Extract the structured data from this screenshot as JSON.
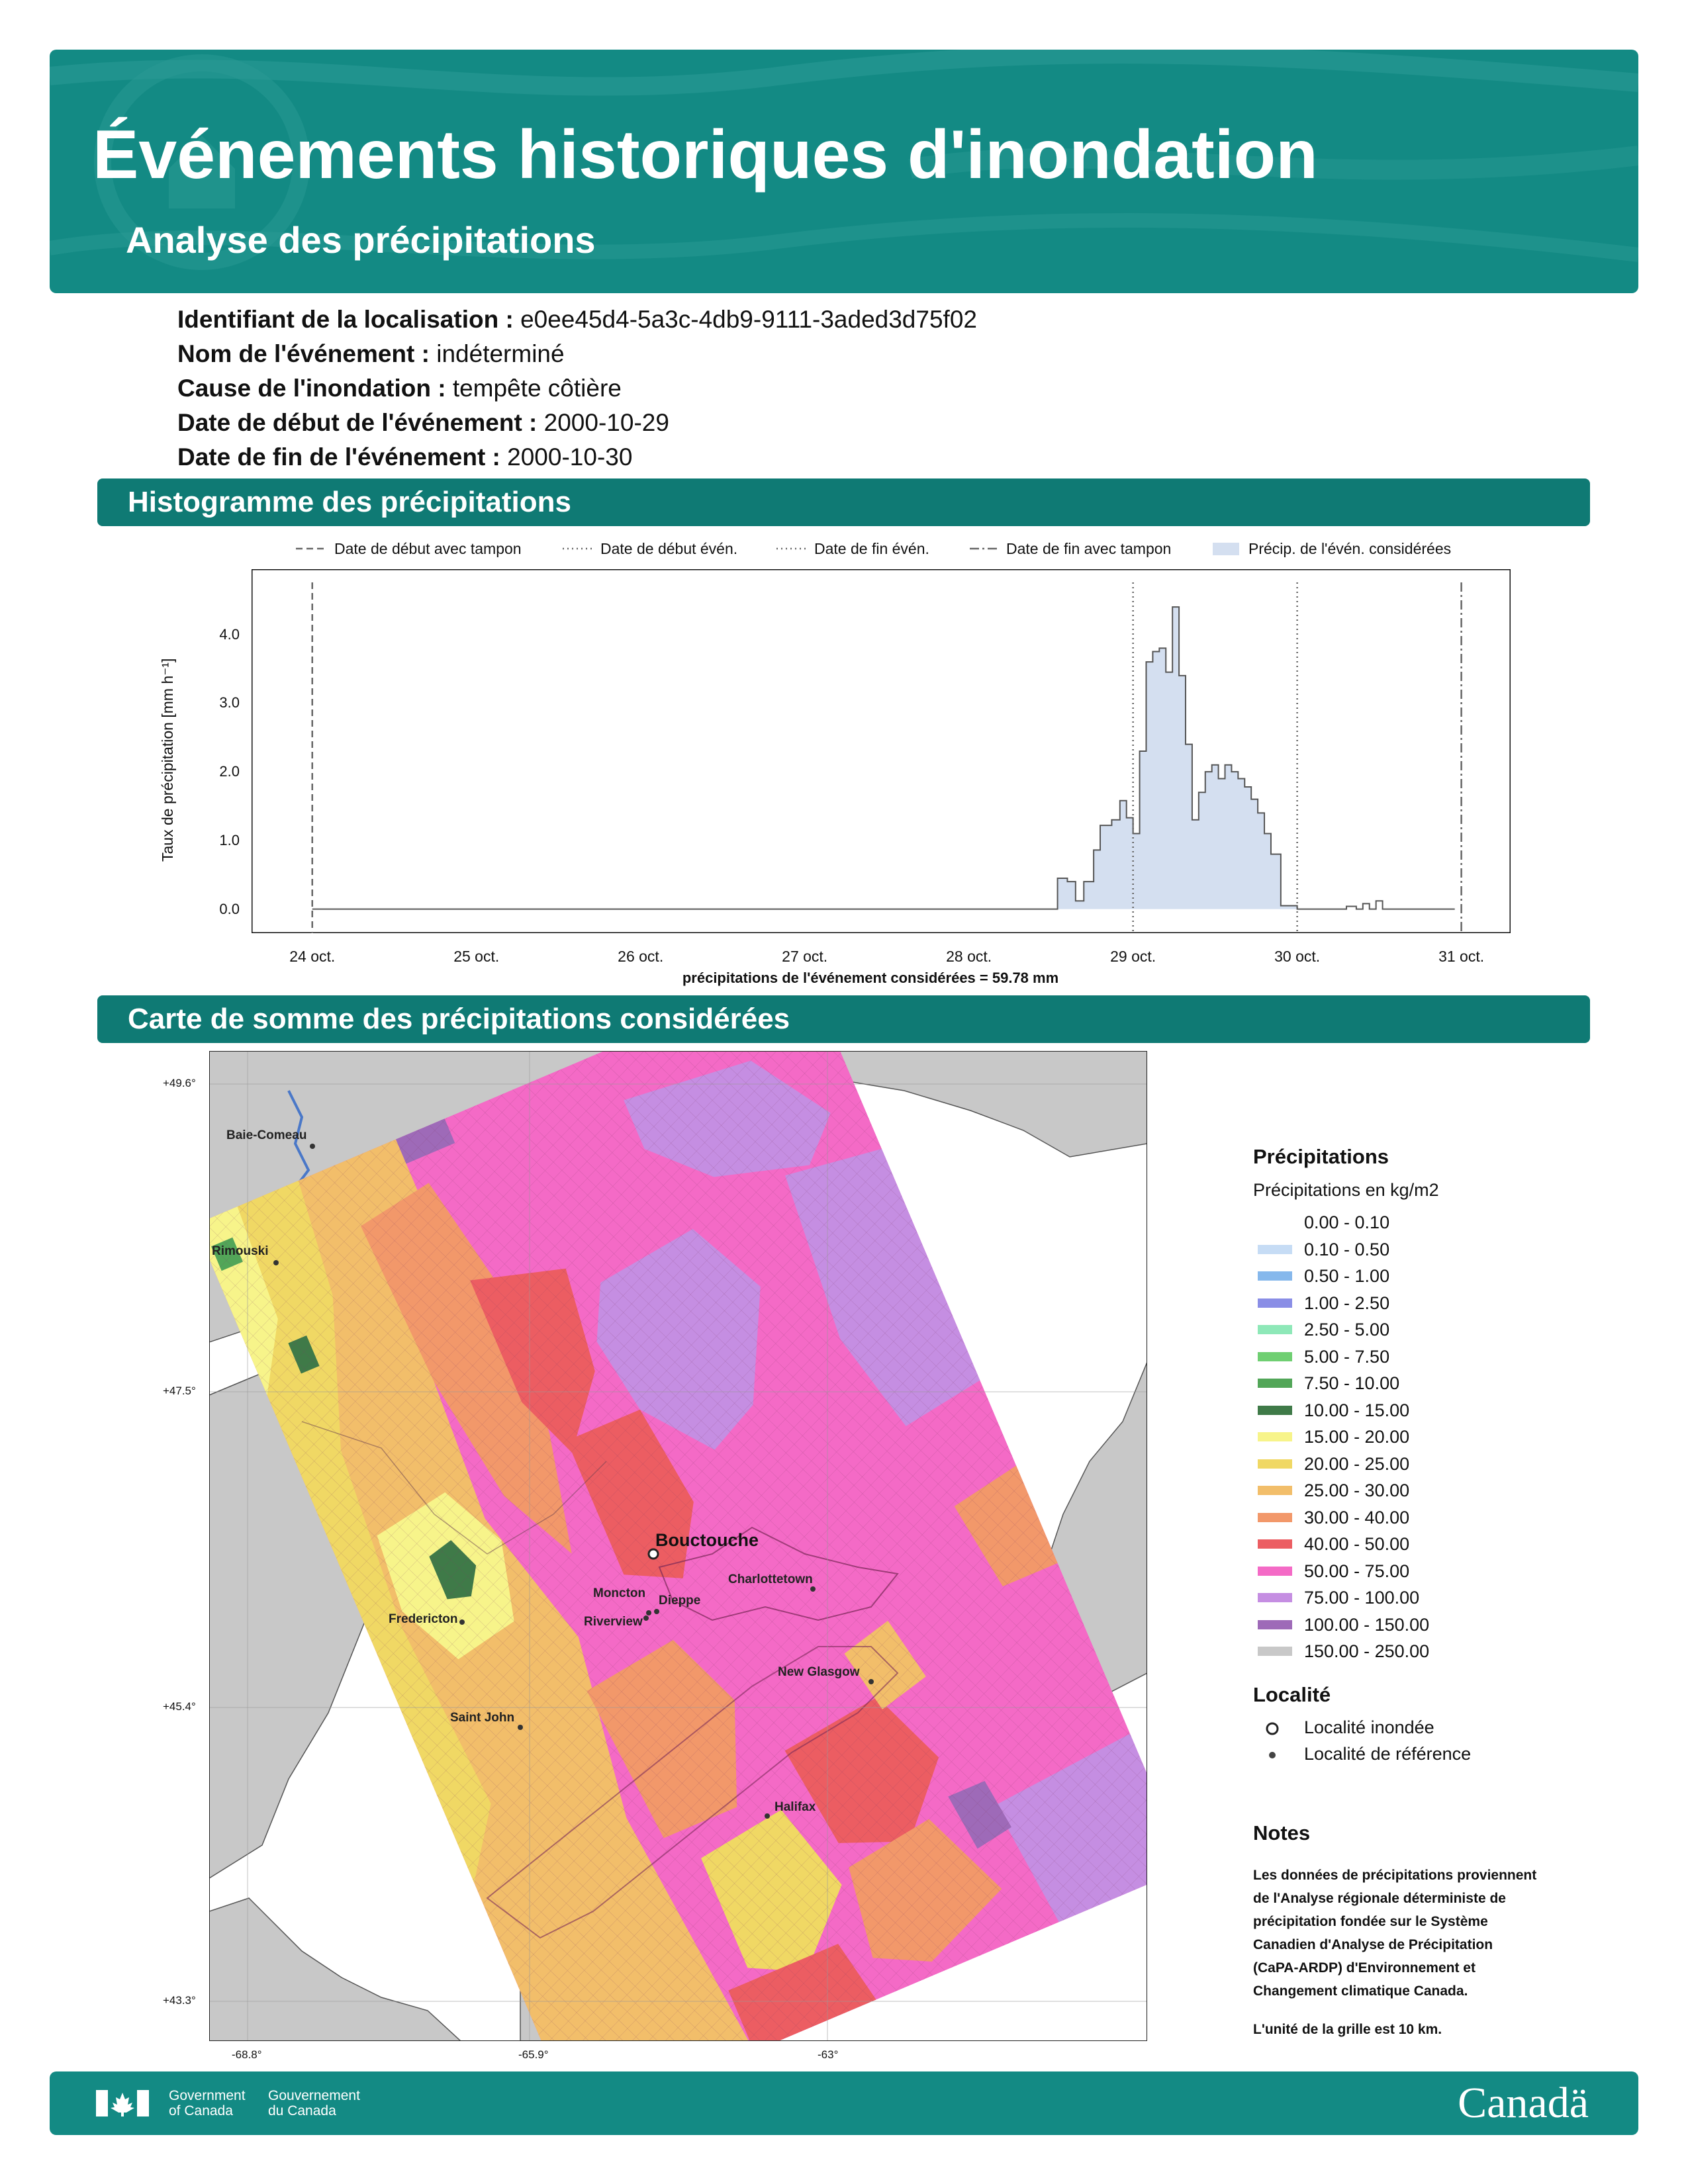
{
  "header": {
    "title": "Événements historiques d'inondation",
    "subtitle": "Analyse des précipitations",
    "background_color": "#138a84"
  },
  "event": [
    {
      "label": "Identifiant de la localisation :",
      "value": "e0ee45d4-5a3c-4db9-9111-3aded3d75f02"
    },
    {
      "label": "Nom de l'événement :",
      "value": "indéterminé"
    },
    {
      "label": "Cause de l'inondation :",
      "value": "tempête côtière"
    },
    {
      "label": "Date de début de l'événement :",
      "value": "2000-10-29"
    },
    {
      "label": "Date de fin de l'événement :",
      "value": "2000-10-30"
    }
  ],
  "sections": {
    "histogram": "Histogramme des précipitations",
    "map": "Carte de somme des précipitations considérées"
  },
  "chart_data": {
    "type": "area",
    "legend": [
      "Date de début avec tampon",
      "Date de début évén.",
      "Date de fin évén.",
      "Date de fin avec tampon",
      "Précip. de l'évén. considérées"
    ],
    "ylabel": "Taux de précipitation [mm h⁻¹]",
    "yticks": [
      "0.0",
      "1.0",
      "2.0",
      "3.0",
      "4.0"
    ],
    "xticks": [
      "24 oct.",
      "25 oct.",
      "26 oct.",
      "27 oct.",
      "28 oct.",
      "29 oct.",
      "30 oct.",
      "31 oct."
    ],
    "xlabel": "précipitations de l'événement considérées = 59.78 mm",
    "ylim": [
      -0.35,
      4.95
    ],
    "xlim_days": [
      23.63,
      31.3
    ],
    "vlines_days": {
      "buffer_start": 24.0,
      "event_start": 29.0,
      "event_end": 30.0,
      "buffer_end": 31.0
    },
    "steps": [
      [
        24.0,
        0.0
      ],
      [
        28.54,
        0.45
      ],
      [
        28.6,
        0.4
      ],
      [
        28.65,
        0.12
      ],
      [
        28.7,
        0.4
      ],
      [
        28.76,
        0.86
      ],
      [
        28.8,
        1.22
      ],
      [
        28.87,
        1.3
      ],
      [
        28.92,
        1.58
      ],
      [
        28.96,
        1.33
      ],
      [
        29.0,
        1.1
      ],
      [
        29.04,
        2.3
      ],
      [
        29.08,
        3.6
      ],
      [
        29.12,
        3.75
      ],
      [
        29.16,
        3.8
      ],
      [
        29.2,
        3.45
      ],
      [
        29.24,
        4.4
      ],
      [
        29.28,
        3.4
      ],
      [
        29.32,
        2.4
      ],
      [
        29.36,
        1.3
      ],
      [
        29.4,
        1.7
      ],
      [
        29.44,
        2.0
      ],
      [
        29.48,
        2.1
      ],
      [
        29.52,
        1.9
      ],
      [
        29.56,
        2.1
      ],
      [
        29.6,
        2.0
      ],
      [
        29.64,
        1.9
      ],
      [
        29.68,
        1.78
      ],
      [
        29.72,
        1.6
      ],
      [
        29.76,
        1.4
      ],
      [
        29.8,
        1.1
      ],
      [
        29.84,
        0.8
      ],
      [
        29.9,
        0.05
      ],
      [
        30.0,
        0.0
      ],
      [
        30.3,
        0.04
      ],
      [
        30.36,
        0.0
      ],
      [
        30.4,
        0.08
      ],
      [
        30.44,
        0.0
      ],
      [
        30.48,
        0.12
      ],
      [
        30.52,
        0.0
      ],
      [
        30.96,
        0.0
      ]
    ],
    "fill_color": "#d4dff0"
  },
  "map": {
    "lat_labels": [
      "+49.6°",
      "+47.5°",
      "+45.4°",
      "+43.3°"
    ],
    "lon_labels": [
      "-68.8°",
      "-65.9°",
      "-63°"
    ],
    "cities": [
      {
        "name": "Baie-Comeau"
      },
      {
        "name": "Rimouski"
      },
      {
        "name": "Bouctouche"
      },
      {
        "name": "Charlottetown"
      },
      {
        "name": "Moncton"
      },
      {
        "name": "Dieppe"
      },
      {
        "name": "Riverview"
      },
      {
        "name": "Fredericton"
      },
      {
        "name": "New Glasgow"
      },
      {
        "name": "Saint John"
      },
      {
        "name": "Halifax"
      }
    ]
  },
  "legend": {
    "title": "Précipitations",
    "subtitle": "Précipitations en kg/m2",
    "classes": [
      {
        "label": "0.00 - 0.10",
        "color": "#ffffff"
      },
      {
        "label": "0.10 - 0.50",
        "color": "#c6dcf5"
      },
      {
        "label": "0.50 - 1.00",
        "color": "#86b8ec"
      },
      {
        "label": "1.00 - 2.50",
        "color": "#8a8ee6"
      },
      {
        "label": "2.50 - 5.00",
        "color": "#8ee8b8"
      },
      {
        "label": "5.00 - 7.50",
        "color": "#6fcf72"
      },
      {
        "label": "7.50 - 10.00",
        "color": "#52a658"
      },
      {
        "label": "10.00 - 15.00",
        "color": "#3f7a48"
      },
      {
        "label": "15.00 - 20.00",
        "color": "#f7f48a"
      },
      {
        "label": "20.00 - 25.00",
        "color": "#f0d864"
      },
      {
        "label": "25.00 - 30.00",
        "color": "#f2be6a"
      },
      {
        "label": "30.00 - 40.00",
        "color": "#f2986a"
      },
      {
        "label": "40.00 - 50.00",
        "color": "#ec5d62"
      },
      {
        "label": "50.00 - 75.00",
        "color": "#f46ac6"
      },
      {
        "label": "75.00 - 100.00",
        "color": "#c58ee2"
      },
      {
        "label": "100.00 - 150.00",
        "color": "#9e6ab8"
      },
      {
        "label": "150.00 - 250.00",
        "color": "#c8c8c8"
      }
    ],
    "locality_title": "Localité",
    "locality_flooded": "Localité inondée",
    "locality_reference": "Localité de référence"
  },
  "notes": {
    "title": "Notes",
    "lines": [
      "Les données de précipitations proviennent",
      "de l'Analyse régionale déterministe de",
      "précipitation fondée sur le Système",
      "Canadien d'Analyse de Précipitation",
      "(CaPA-ARDP) d'Environnement et",
      "Changement climatique Canada."
    ],
    "grid_unit": "L'unité de la grille est 10 km."
  },
  "footer": {
    "gov_en_1": "Government",
    "gov_en_2": "of Canada",
    "gov_fr_1": "Gouvernement",
    "gov_fr_2": "du Canada",
    "wordmark": "Canadä"
  }
}
